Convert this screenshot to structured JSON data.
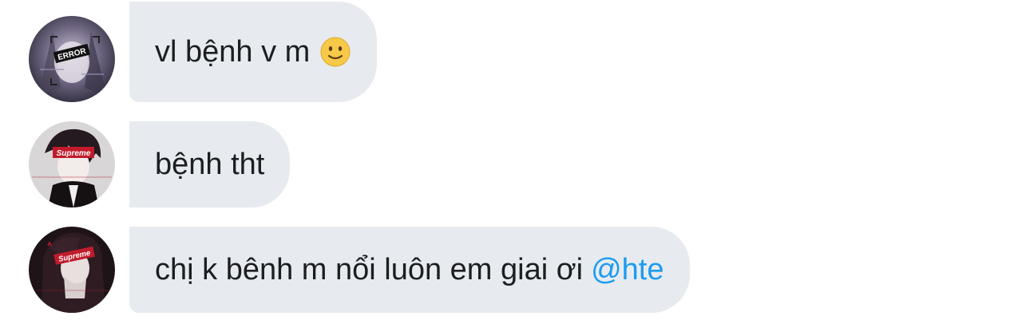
{
  "messages": [
    {
      "text": "vl bệnh v m",
      "emoji": "slightly-smiling-face"
    },
    {
      "text": "bệnh tht"
    },
    {
      "text": "chị k bênh m nổi luôn em giai ơi",
      "mention": "@hte"
    }
  ],
  "avatars": [
    {
      "label": "ERROR"
    },
    {
      "label": "Supreme"
    },
    {
      "label": "Supreme"
    }
  ],
  "colors": {
    "bubble": "#e7ebf0",
    "text": "#1c1e21",
    "mention": "#1d9bf0"
  }
}
